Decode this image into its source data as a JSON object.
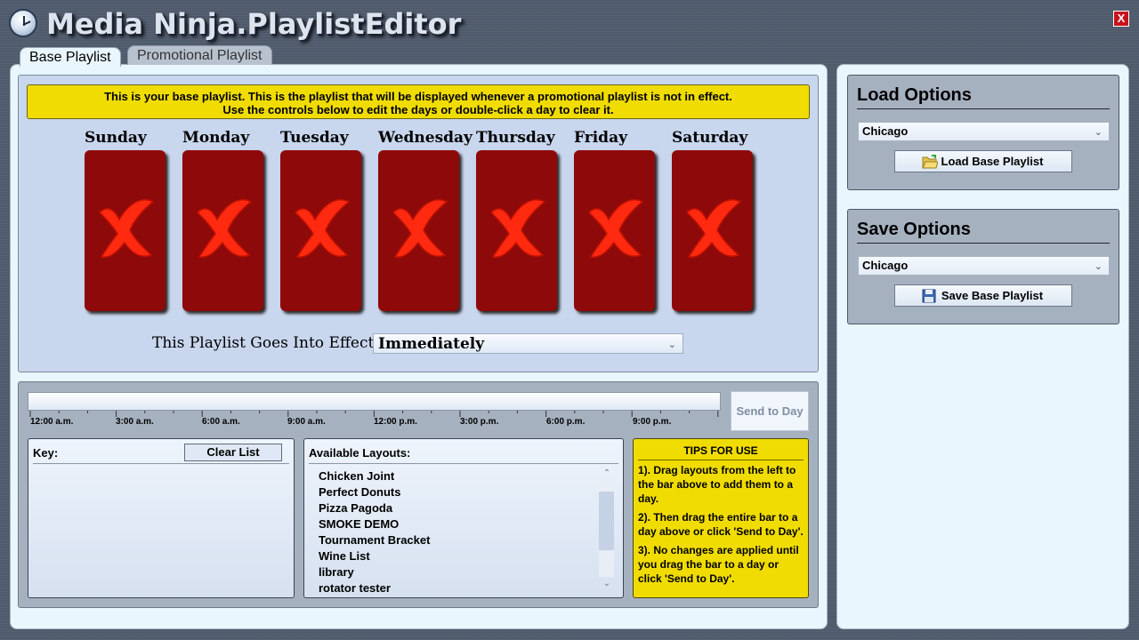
{
  "app": {
    "title": "Media Ninja.PlaylistEditor",
    "close_label": "X"
  },
  "tabs": [
    {
      "label": "Base Playlist",
      "active": true
    },
    {
      "label": "Promotional Playlist",
      "active": false
    }
  ],
  "banner": {
    "line1": "This is your base playlist. This is the playlist that will be displayed whenever a promotional playlist is not in effect.",
    "line2": "Use the controls below to edit the days or double-click a day to clear it."
  },
  "days": [
    {
      "label": "Sunday",
      "state": "empty"
    },
    {
      "label": "Monday",
      "state": "empty"
    },
    {
      "label": "Tuesday",
      "state": "empty"
    },
    {
      "label": "Wednesday",
      "state": "empty"
    },
    {
      "label": "Thursday",
      "state": "empty"
    },
    {
      "label": "Friday",
      "state": "empty"
    },
    {
      "label": "Saturday",
      "state": "empty"
    }
  ],
  "effect": {
    "label": "This Playlist Goes Into Effect:",
    "value": "Immediately"
  },
  "timeline": {
    "labels": [
      "12:00 a.m.",
      "3:00 a.m.",
      "6:00 a.m.",
      "9:00 a.m.",
      "12:00 p.m.",
      "3:00 p.m.",
      "6:00 p.m.",
      "9:00 p.m."
    ],
    "send_button": "Send to Day"
  },
  "key": {
    "title": "Key:",
    "clear_button": "Clear List"
  },
  "layouts": {
    "title": "Available Layouts:",
    "items": [
      "Chicken Joint",
      "Perfect Donuts",
      "Pizza Pagoda",
      "SMOKE DEMO",
      "Tournament Bracket",
      "Wine List",
      "library",
      "rotator tester"
    ]
  },
  "tips": {
    "title": "TIPS FOR USE",
    "items": [
      "1). Drag layouts from the left to the bar above to add them to a day.",
      "2). Then drag the entire bar to a day above or click 'Send to Day'.",
      "3). No changes are applied until you drag the bar to a day or click 'Send to Day'."
    ]
  },
  "load_options": {
    "title": "Load Options",
    "location": "Chicago",
    "button": "Load Base Playlist"
  },
  "save_options": {
    "title": "Save Options",
    "location": "Chicago",
    "button": "Save Base Playlist"
  },
  "colors": {
    "banner": "#f0dc00",
    "day_card": "#8e0a0a",
    "x_mark": "#ff2a10",
    "close": "#c8121a"
  }
}
